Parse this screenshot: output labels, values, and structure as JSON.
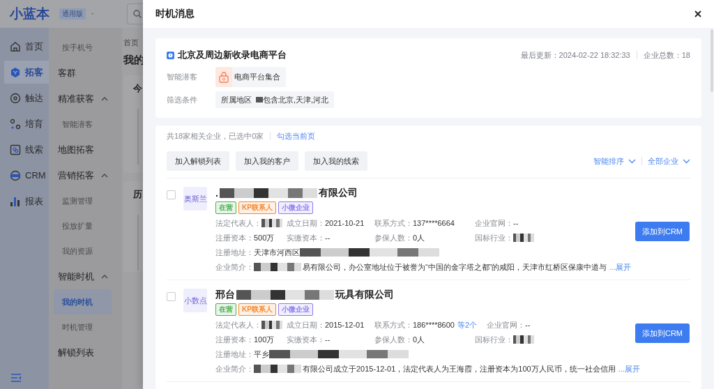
{
  "app": {
    "logo": "小蓝本",
    "edition": "通用版"
  },
  "nav": [
    {
      "label": "首页",
      "selected": false
    },
    {
      "label": "拓客",
      "selected": true
    },
    {
      "label": "触达",
      "selected": false
    },
    {
      "label": "培育",
      "selected": false
    },
    {
      "label": "线索",
      "selected": false
    },
    {
      "label": "CRM",
      "selected": false
    },
    {
      "label": "报表",
      "selected": false
    }
  ],
  "submenu": [
    {
      "kind": "item",
      "label": "按手机号",
      "selected": false
    },
    {
      "kind": "section",
      "label": "客群"
    },
    {
      "kind": "section",
      "label": "精准获客",
      "expanded": true
    },
    {
      "kind": "item",
      "label": "智能潜客",
      "selected": false
    },
    {
      "kind": "section",
      "label": "地图拓客"
    },
    {
      "kind": "section",
      "label": "营销拓客",
      "expanded": true
    },
    {
      "kind": "item",
      "label": "监测管理",
      "selected": false
    },
    {
      "kind": "item",
      "label": "投放扩量",
      "selected": false
    },
    {
      "kind": "item",
      "label": "我的资源",
      "selected": false
    },
    {
      "kind": "section",
      "label": "智能时机",
      "expanded": true
    },
    {
      "kind": "item",
      "label": "我的时机",
      "selected": true
    },
    {
      "kind": "item",
      "label": "时机管理",
      "selected": false
    },
    {
      "kind": "section",
      "label": "解锁列表"
    }
  ],
  "main": {
    "breadcrumb": "首页",
    "page_title": "我的",
    "card_titles": [
      "今",
      "历"
    ]
  },
  "drawer": {
    "title": "时机消息",
    "opportunity": {
      "title": "北京及周边新收录电商平台",
      "updated": "最后更新：2024-02-22 18:32:33",
      "total": "企业总数：18",
      "source_label": "智能潜客",
      "source": "电商平台集合",
      "filter_label": "筛选条件",
      "filter_field": "所属地区",
      "filter_value": "包含北京,天津,河北"
    },
    "summary": "共18家相关企业，已选中0家",
    "select_page": "勾选当前页",
    "actions": [
      "加入解锁列表",
      "加入我的客户",
      "加入我的线索"
    ],
    "sort": "智能排序",
    "scope": "全部企业",
    "companies": [
      {
        "checked": false,
        "logo": "奥斯兰",
        "name_before": ".",
        "name_after": "有限公司",
        "tags": [
          {
            "label": "在营",
            "color": "#4caf50"
          },
          {
            "label": "KP联系人",
            "color": "#f5872c"
          },
          {
            "label": "小微企业",
            "color": "#8c7cf0"
          }
        ],
        "rows": [
          [
            {
              "label": "法定代表人：",
              "redacted": true
            },
            {
              "label": "成立日期：",
              "value": "2021-10-21"
            },
            {
              "label": "联系方式：",
              "value": "137****6664"
            },
            {
              "label": "企业官网：",
              "value": "--"
            }
          ],
          [
            {
              "label": "注册资本：",
              "value": "500万"
            },
            {
              "label": "实缴资本：",
              "value": "--"
            },
            {
              "label": "参保人数：",
              "value": "0人"
            },
            {
              "label": "国标行业：",
              "redacted": true
            }
          ],
          [
            {
              "label": "注册地址：",
              "value": "天津市河西区",
              "redacted": true
            }
          ]
        ],
        "intro_label": "企业简介：",
        "intro": "易有限公司，办公室地址位于被誉为“中国的金字塔之都”的咸阳，天津市红桥区保康中道与",
        "expand": "...展开",
        "button": "添加到CRM"
      },
      {
        "checked": false,
        "logo": "小数点",
        "name_before": "邢台",
        "name_after": "玩具有限公司",
        "tags": [
          {
            "label": "在营",
            "color": "#4caf50"
          },
          {
            "label": "KP联系人",
            "color": "#f5872c"
          },
          {
            "label": "小微企业",
            "color": "#8c7cf0"
          }
        ],
        "rows": [
          [
            {
              "label": "法定代表人：",
              "redacted": true
            },
            {
              "label": "成立日期：",
              "value": "2015-12-01"
            },
            {
              "label": "联系方式：",
              "value": "186****8600",
              "more": "等2个"
            },
            {
              "label": "企业官网：",
              "value": "--"
            }
          ],
          [
            {
              "label": "注册资本：",
              "value": "100万"
            },
            {
              "label": "实缴资本：",
              "value": "--"
            },
            {
              "label": "参保人数：",
              "value": "0人"
            },
            {
              "label": "国标行业：",
              "redacted": true
            }
          ],
          [
            {
              "label": "注册地址：",
              "value": "平乡",
              "redacted": true
            }
          ]
        ],
        "intro_label": "企业简介：",
        "intro": "有限公司成立于2015-12-01，法定代表人为王海霞，注册资本为100万人民币，统一社会信用",
        "expand": "...展开",
        "button": "添加到CRM"
      }
    ]
  }
}
